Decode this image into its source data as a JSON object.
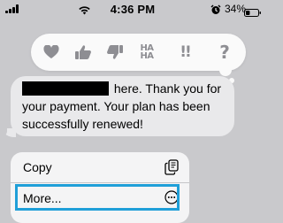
{
  "status_bar": {
    "time": "4:36 PM",
    "battery_percent": "34%",
    "battery_level": 0.34,
    "signal_bars": 4
  },
  "reactions": [
    {
      "name": "heart",
      "icon": "heart-icon"
    },
    {
      "name": "thumbs-up",
      "icon": "thumbs-up-icon"
    },
    {
      "name": "thumbs-down",
      "icon": "thumbs-down-icon"
    },
    {
      "name": "haha",
      "text_top": "HA",
      "text_bottom": "HA"
    },
    {
      "name": "emphasize",
      "text": "!!"
    },
    {
      "name": "question",
      "text": "?"
    }
  ],
  "message": {
    "text": " here. Thank you for your payment. Your plan has been successfully renewed!",
    "redacted": true
  },
  "context_menu": {
    "copy_label": "Copy",
    "copy_icon": "copy-icon",
    "more_label": "More...",
    "more_icon": "ellipsis-circle-icon"
  },
  "colors": {
    "background": "#c9c9cc",
    "bubble": "#e9e9eb",
    "reaction_bar": "#fafafa",
    "reaction_icon": "#8e8e93",
    "highlight": "#1f9fd8"
  }
}
